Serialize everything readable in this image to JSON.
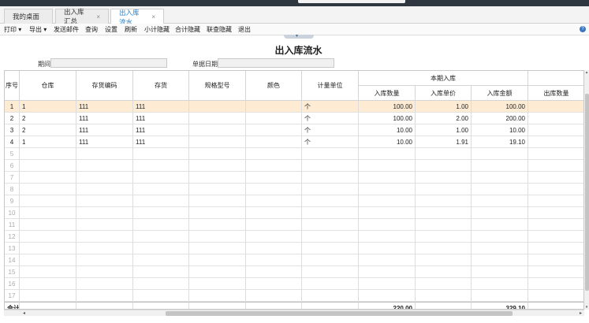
{
  "tabs": [
    {
      "label": "我的桌面",
      "closable": false,
      "active": false
    },
    {
      "label": "出入库汇总",
      "closable": true,
      "active": false
    },
    {
      "label": "出入库流水",
      "closable": true,
      "active": true
    }
  ],
  "close_glyph": "×",
  "toolbar": {
    "print": "打印",
    "export": "导出",
    "send_mail": "发送邮件",
    "query": "查询",
    "settings": "设置",
    "refresh": "刷新",
    "subtotal_toggle": "小计隐藏",
    "total_toggle": "合计隐藏",
    "joined_toggle": "联查隐藏",
    "exit": "退出",
    "dropdown_glyph": "▾",
    "help_icon": "question-icon",
    "help_glyph": "?"
  },
  "collapse_glyph": "▾",
  "report": {
    "title": "出入库流水",
    "period_label": "期间",
    "doc_date_label": "单据日期"
  },
  "table": {
    "headers": {
      "seq": "序号",
      "warehouse": "仓库",
      "item_code": "存货编码",
      "item": "存货",
      "spec": "规格型号",
      "color": "颜色",
      "unit": "计量单位",
      "current_in_group": "本期入库",
      "in_qty": "入库数量",
      "in_price": "入库单价",
      "in_amount": "入库金额",
      "out_qty": "出库数量"
    },
    "rows": [
      {
        "seq": "1",
        "warehouse": "1",
        "item_code": "111",
        "item": "111",
        "spec": "",
        "color": "",
        "unit": "个",
        "in_qty": "100.00",
        "in_price": "1.00",
        "in_amount": "100.00",
        "out_qty": ""
      },
      {
        "seq": "2",
        "warehouse": "2",
        "item_code": "111",
        "item": "111",
        "spec": "",
        "color": "",
        "unit": "个",
        "in_qty": "100.00",
        "in_price": "2.00",
        "in_amount": "200.00",
        "out_qty": ""
      },
      {
        "seq": "3",
        "warehouse": "2",
        "item_code": "111",
        "item": "111",
        "spec": "",
        "color": "",
        "unit": "个",
        "in_qty": "10.00",
        "in_price": "1.00",
        "in_amount": "10.00",
        "out_qty": ""
      },
      {
        "seq": "4",
        "warehouse": "1",
        "item_code": "111",
        "item": "111",
        "spec": "",
        "color": "",
        "unit": "个",
        "in_qty": "10.00",
        "in_price": "1.91",
        "in_amount": "19.10",
        "out_qty": ""
      }
    ],
    "empty_row_numbers": [
      "5",
      "6",
      "7",
      "8",
      "9",
      "10",
      "11",
      "12",
      "13",
      "14",
      "15",
      "16",
      "17"
    ],
    "total": {
      "label": "合计",
      "in_qty": "220.00",
      "in_amount": "329.10"
    }
  },
  "scrollbar": {
    "left_glyph": "◂",
    "right_glyph": "▸",
    "up_glyph": "▴",
    "down_glyph": "▾"
  }
}
